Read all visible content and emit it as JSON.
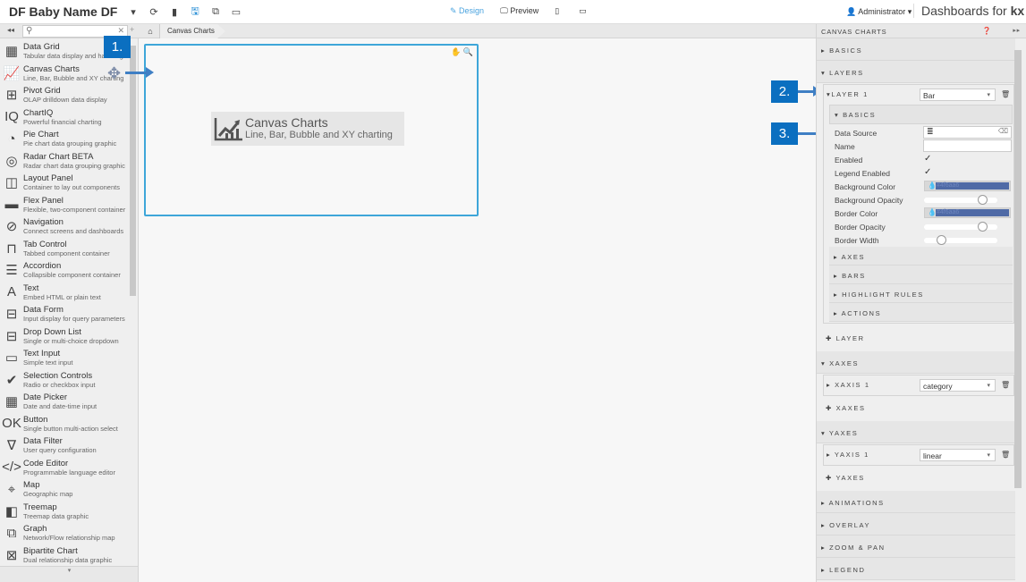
{
  "header": {
    "app_title": "DF Baby Name DF",
    "icons": [
      "dropdown-caret-icon",
      "refresh-icon",
      "new-document-icon",
      "save-icon",
      "copy-icon",
      "settings-icon"
    ],
    "mode_design": "Design",
    "mode_preview": "Preview",
    "user": "Administrator",
    "brand_prefix": "Dashboards for ",
    "brand_suffix": "kx"
  },
  "toolbar": {
    "search_placeholder": "",
    "breadcrumb": [
      "Canvas Charts"
    ]
  },
  "sidebar": {
    "items": [
      {
        "name": "Data Grid",
        "desc": "Tabular data display and handling",
        "icon": "grid-icon"
      },
      {
        "name": "Canvas Charts",
        "desc": "Line, Bar, Bubble and XY charting",
        "icon": "line-chart-icon"
      },
      {
        "name": "Pivot Grid",
        "desc": "OLAP drilldown data display",
        "icon": "pivot-grid-icon"
      },
      {
        "name": "ChartIQ",
        "desc": "Powerful financial charting",
        "icon": "chartiq-icon"
      },
      {
        "name": "Pie Chart",
        "desc": "Pie chart data grouping graphic",
        "icon": "pie-chart-icon"
      },
      {
        "name": "Radar Chart BETA",
        "desc": "Radar chart data grouping graphic",
        "icon": "radar-icon"
      },
      {
        "name": "Layout Panel",
        "desc": "Container to lay out components",
        "icon": "layout-panel-icon"
      },
      {
        "name": "Flex Panel",
        "desc": "Flexible, two-component container",
        "icon": "flex-panel-icon"
      },
      {
        "name": "Navigation",
        "desc": "Connect screens and dashboards",
        "icon": "compass-icon"
      },
      {
        "name": "Tab Control",
        "desc": "Tabbed component container",
        "icon": "tab-icon"
      },
      {
        "name": "Accordion",
        "desc": "Collapsible component container",
        "icon": "accordion-icon"
      },
      {
        "name": "Text",
        "desc": "Embed HTML or plain text",
        "icon": "text-icon"
      },
      {
        "name": "Data Form",
        "desc": "Input display for query parameters",
        "icon": "form-icon"
      },
      {
        "name": "Drop Down List",
        "desc": "Single or multi-choice dropdown",
        "icon": "dropdown-list-icon"
      },
      {
        "name": "Text Input",
        "desc": "Simple text input",
        "icon": "text-input-icon"
      },
      {
        "name": "Selection Controls",
        "desc": "Radio or checkbox input",
        "icon": "check-circle-icon"
      },
      {
        "name": "Date Picker",
        "desc": "Date and date-time input",
        "icon": "calendar-icon"
      },
      {
        "name": "Button",
        "desc": "Single button multi-action select",
        "icon": "ok-button-icon"
      },
      {
        "name": "Data Filter",
        "desc": "User query configuration",
        "icon": "filter-icon"
      },
      {
        "name": "Code Editor",
        "desc": "Programmable language editor",
        "icon": "code-icon"
      },
      {
        "name": "Map",
        "desc": "Geographic map",
        "icon": "map-icon"
      },
      {
        "name": "Treemap",
        "desc": "Treemap data graphic",
        "icon": "treemap-icon"
      },
      {
        "name": "Graph",
        "desc": "Network/Flow relationship map",
        "icon": "network-icon"
      },
      {
        "name": "Bipartite Chart",
        "desc": "Dual relationship data graphic",
        "icon": "bipartite-icon"
      }
    ],
    "glyphs": [
      "▦",
      "📈",
      "⊞",
      "IQ",
      "◔",
      "◎",
      "◫",
      "▬",
      "⊘",
      "⊓",
      "☰",
      "A",
      "⊟",
      "⊟",
      "▭",
      "✔",
      "▦",
      "OK",
      "∇",
      "</>",
      "⌖",
      "◧",
      "⧉",
      "⊠"
    ]
  },
  "canvas": {
    "widget_title": "Canvas Charts",
    "widget_desc": "Line, Bar, Bubble and XY charting"
  },
  "callouts": [
    "1.",
    "2.",
    "3."
  ],
  "properties": {
    "panel_title": "CANVAS CHARTS",
    "sections": {
      "basics": "BASICS",
      "layers": "LAYERS",
      "layer1": "LAYER 1",
      "layer1_type": "Bar",
      "layer_basics": "BASICS",
      "axes": "AXES",
      "bars": "BARS",
      "highlight_rules": "HIGHLIGHT RULES",
      "actions": "ACTIONS",
      "add_layer": "LAYER",
      "xaxes": "XAXES",
      "xaxis1": "XAXIS 1",
      "xaxis1_type": "category",
      "add_xaxes": "XAXES",
      "yaxes": "YAXES",
      "yaxis1": "YAXIS 1",
      "yaxis1_type": "linear",
      "add_yaxes": "YAXES",
      "animations": "ANIMATIONS",
      "overlay": "OVERLAY",
      "zoom_pan": "ZOOM & PAN",
      "legend": "LEGEND"
    },
    "fields": {
      "data_source": "Data Source",
      "name": "Name",
      "name_value": "",
      "enabled": "Enabled",
      "enabled_value": true,
      "legend_enabled": "Legend Enabled",
      "legend_enabled_value": true,
      "background_color": "Background Color",
      "background_color_value": "#4f6aa6",
      "background_opacity": "Background Opacity",
      "background_opacity_value": 0.85,
      "border_color": "Border Color",
      "border_color_value": "#4f6aa6",
      "border_opacity": "Border Opacity",
      "border_opacity_value": 0.85,
      "border_width": "Border Width",
      "border_width_value": 0.2
    },
    "check_glyph": "✓"
  },
  "colors": {
    "accent": "#3ea6d9",
    "callout": "#0b6fc0",
    "swatch": "#4f6aa6"
  }
}
